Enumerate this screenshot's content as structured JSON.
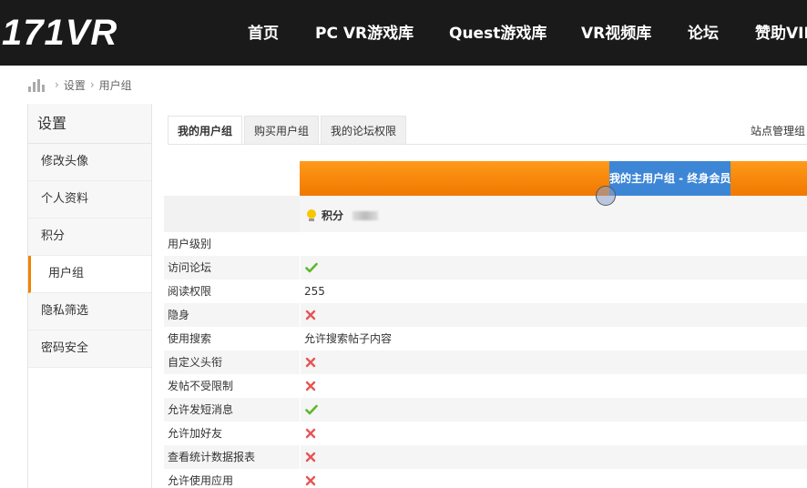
{
  "site": {
    "logo": "171VR"
  },
  "nav": [
    {
      "label": "首页"
    },
    {
      "label": "PC VR游戏库"
    },
    {
      "label": "Quest游戏库"
    },
    {
      "label": "VR视频库"
    },
    {
      "label": "论坛"
    },
    {
      "label": "赞助VIP"
    }
  ],
  "breadcrumb": {
    "items": [
      "设置",
      "用户组"
    ],
    "separator": "›"
  },
  "sidebar": {
    "title": "设置",
    "items": [
      {
        "label": "修改头像"
      },
      {
        "label": "个人资料"
      },
      {
        "label": "积分"
      },
      {
        "label": "用户组"
      },
      {
        "label": "隐私筛选"
      },
      {
        "label": "密码安全"
      }
    ]
  },
  "tabs": [
    {
      "label": "我的用户组"
    },
    {
      "label": "购买用户组"
    },
    {
      "label": "我的论坛权限"
    }
  ],
  "site_admin": "站点管理组",
  "table": {
    "group_header": "我的主用户组 - 终身会员",
    "score_label": "积分",
    "rows": [
      {
        "label": "用户级别",
        "value": ""
      },
      {
        "label": "访问论坛",
        "value": "check"
      },
      {
        "label": "阅读权限",
        "value": "255"
      },
      {
        "label": "隐身",
        "value": "cross"
      },
      {
        "label": "使用搜索",
        "value": "允许搜索帖子内容"
      },
      {
        "label": "自定义头衔",
        "value": "cross"
      },
      {
        "label": "发帖不受限制",
        "value": "cross"
      },
      {
        "label": "允许发短消息",
        "value": "check"
      },
      {
        "label": "允许加好友",
        "value": "cross"
      },
      {
        "label": "查看统计数据报表",
        "value": "cross"
      },
      {
        "label": "允许使用应用",
        "value": "cross"
      }
    ]
  },
  "colors": {
    "accent": "#f08300",
    "header_bg": "#1a1a1a",
    "group_blue": "#3d86d6",
    "check": "#5cb82e",
    "cross": "#e85454"
  },
  "icons": {
    "home": "stats-bars-icon",
    "score": "lightbulb-icon",
    "yes": "check-icon",
    "no": "cross-icon"
  }
}
